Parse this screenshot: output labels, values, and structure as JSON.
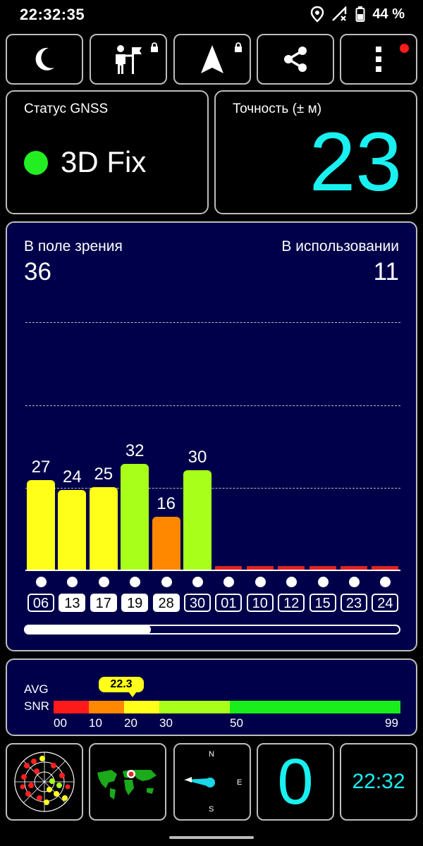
{
  "status_bar": {
    "time": "22:32:35",
    "battery_percent": "44 %"
  },
  "toolbar": {
    "buttons": [
      {
        "icon": "moon-icon"
      },
      {
        "icon": "person-flag-icon",
        "locked": true
      },
      {
        "icon": "navigation-arrow-icon",
        "locked": true
      },
      {
        "icon": "share-icon"
      },
      {
        "icon": "more-vert-icon",
        "notification": true
      }
    ]
  },
  "gnss_status": {
    "label": "Статус GNSS",
    "value": "3D Fix",
    "indicator_color": "#22ee22"
  },
  "accuracy": {
    "label": "Точность (± м)",
    "value": "23",
    "color": "#19f0f0"
  },
  "satellites": {
    "in_view_label": "В поле зрения",
    "in_view_value": "36",
    "in_use_label": "В использовании",
    "in_use_value": "11"
  },
  "chart_data": {
    "type": "bar",
    "categories": [
      "06",
      "13",
      "17",
      "19",
      "28",
      "30",
      "01",
      "10",
      "12",
      "15",
      "23",
      "24"
    ],
    "values": [
      27,
      24,
      25,
      32,
      16,
      30,
      0,
      0,
      0,
      0,
      0,
      0
    ],
    "used": [
      false,
      true,
      true,
      true,
      true,
      false,
      false,
      false,
      false,
      false,
      false,
      false
    ],
    "colors": [
      "#ffff1a",
      "#ffff1a",
      "#ffff1a",
      "#a8ff1a",
      "#ff8800",
      "#a8ff1a",
      "#e22222",
      "#e22222",
      "#e22222",
      "#e22222",
      "#e22222",
      "#e22222"
    ],
    "ylim": [
      0,
      40
    ],
    "grid": true
  },
  "snr": {
    "label_line1": "AVG",
    "label_line2": "SNR",
    "average": "22.3",
    "ticks": [
      "00",
      "10",
      "20",
      "30",
      "50",
      "99"
    ]
  },
  "bottom_tiles": {
    "skyview_icon": "sky-plot-icon",
    "map_icon": "world-map-icon",
    "compass": {
      "n": "N",
      "e": "E",
      "s": "S"
    },
    "speed": "0",
    "clock": "22:32"
  }
}
